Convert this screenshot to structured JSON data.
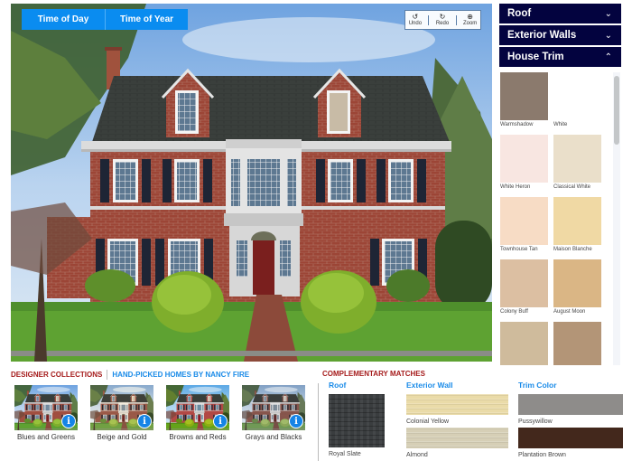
{
  "visualizer": {
    "time_tabs": [
      {
        "label": "Time of Day"
      },
      {
        "label": "Time of Year"
      }
    ],
    "tools": [
      {
        "label": "Undo",
        "icon": "undo-icon",
        "glyph": "↺"
      },
      {
        "label": "Redo",
        "icon": "redo-icon",
        "glyph": "↻"
      },
      {
        "label": "Zoom",
        "icon": "zoom-icon",
        "glyph": "⊕"
      }
    ]
  },
  "panel": {
    "sections": [
      {
        "label": "Roof",
        "state": "collapsed",
        "chevron": "⌄"
      },
      {
        "label": "Exterior Walls",
        "state": "collapsed",
        "chevron": "⌄"
      },
      {
        "label": "House Trim",
        "state": "expanded",
        "chevron": "⌃"
      }
    ],
    "swatches": [
      {
        "name": "Warmshadow",
        "color": "#8b7a6d"
      },
      {
        "name": "White",
        "color": "#ffffff"
      },
      {
        "name": "White Heron",
        "color": "#f8e6e1"
      },
      {
        "name": "Classical White",
        "color": "#eadfca"
      },
      {
        "name": "Townhouse Tan",
        "color": "#f7dcc5"
      },
      {
        "name": "Maison Blanche",
        "color": "#f0d9a4"
      },
      {
        "name": "Colony Buff",
        "color": "#dcbfa2"
      },
      {
        "name": "August Moon",
        "color": "#dab685"
      },
      {
        "name": "",
        "color": "#cfbb9c"
      },
      {
        "name": "",
        "color": "#b39577"
      }
    ]
  },
  "collections": {
    "title": "DESIGNER COLLECTIONS",
    "subtitle": "HAND-PICKED HOMES BY NANCY FIRE",
    "info_glyph": "i",
    "items": [
      {
        "label": "Blues and Greens"
      },
      {
        "label": "Beige and Gold"
      },
      {
        "label": "Browns and Reds"
      },
      {
        "label": "Grays and Blacks"
      }
    ]
  },
  "matches": {
    "title": "COMPLEMENTARY MATCHES",
    "roof": {
      "title": "Roof",
      "items": [
        {
          "name": "Royal Slate",
          "color": "#3a3d3f"
        }
      ]
    },
    "exterior_wall": {
      "title": "Exterior Wall",
      "items": [
        {
          "name": "Colonial Yellow",
          "color": "#eadba8"
        },
        {
          "name": "Almond",
          "color": "#d6cfb6"
        }
      ]
    },
    "trim": {
      "title": "Trim Color",
      "items": [
        {
          "name": "Pussywillow",
          "color": "#8e8c8a"
        },
        {
          "name": "Plantation Brown",
          "color": "#43281c"
        }
      ]
    }
  }
}
